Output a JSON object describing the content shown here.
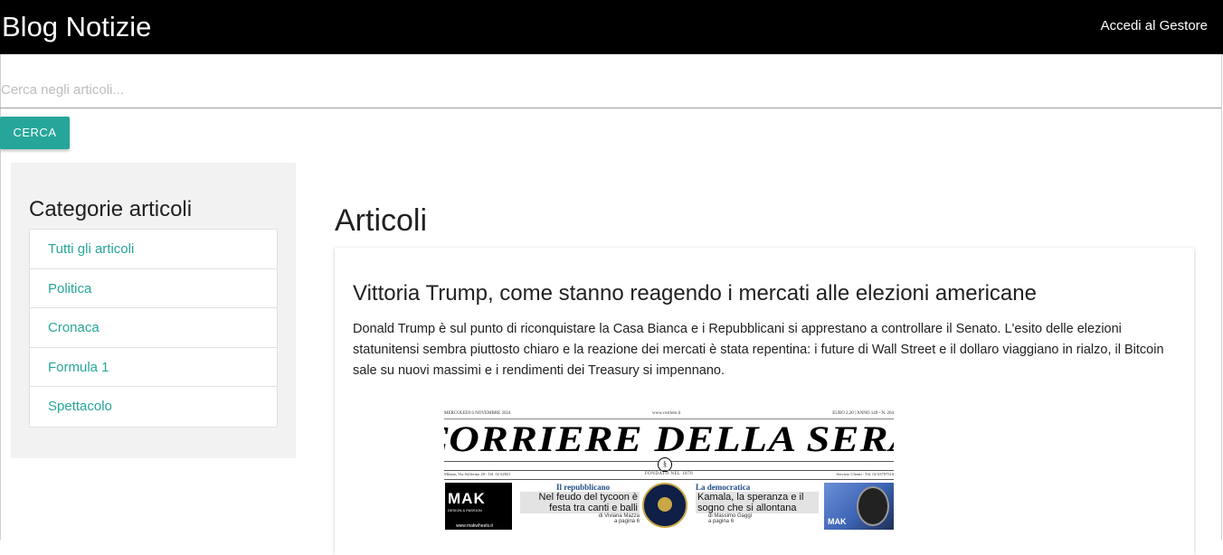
{
  "navbar": {
    "brand": "Blog Notizie",
    "login_link": "Accedi al Gestore"
  },
  "search": {
    "placeholder": "Cerca negli articoli...",
    "button_label": "CERCA"
  },
  "sidebar": {
    "title": "Categorie articoli",
    "items": [
      {
        "label": "Tutti gli articoli"
      },
      {
        "label": "Politica"
      },
      {
        "label": "Cronaca"
      },
      {
        "label": "Formula 1"
      },
      {
        "label": "Spettacolo"
      }
    ]
  },
  "main": {
    "title": "Articoli",
    "articles": [
      {
        "title": "Vittoria Trump, come stanno reagendo i mercati alle elezioni americane",
        "body": "Donald Trump è sul punto di riconquistare la Casa Bianca e i Repubblicani si apprestano a controllare il Senato. L'esito delle elezioni statunitensi sembra piuttosto chiaro e la reazione dei mercati è stata repentina: i future di Wall Street e il dollaro viaggiano in rialzo, il Bitcoin sale su nuovi massimi e i rendimenti dei Treasury si impennano.",
        "image": {
          "date_line": "MERCOLEDÌ 6 NOVEMBRE 2024",
          "site": "www.corriere.it",
          "price_line": "EURO 2,20 | ANNO 149 - N. 264",
          "masthead": "CORRIERE DELLA SERA",
          "founded": "FONDATO NEL 1876",
          "left_address": "Milano, Via Solferino 28 - Tel. 02 62821",
          "right_service": "Servizio Clienti - Tel. 02 63797510",
          "ad_left_brand": "MAK",
          "ad_left_tagline": "DESIGN & PASSION",
          "ad_left_url": "www.makwheels.it",
          "story_left": {
            "kicker": "Il repubblicano",
            "headline": "Nel feudo del tycoon è festa tra canti e balli",
            "byline": "di Viviana Mazza",
            "page": "a pagina 6"
          },
          "story_right": {
            "kicker": "La democratica",
            "headline": "Kamala, la speranza e il sogno che si allontana",
            "byline": "di Massimo Gaggi",
            "page": "a pagina 6"
          },
          "ad_right_brand": "MAK"
        }
      }
    ]
  }
}
